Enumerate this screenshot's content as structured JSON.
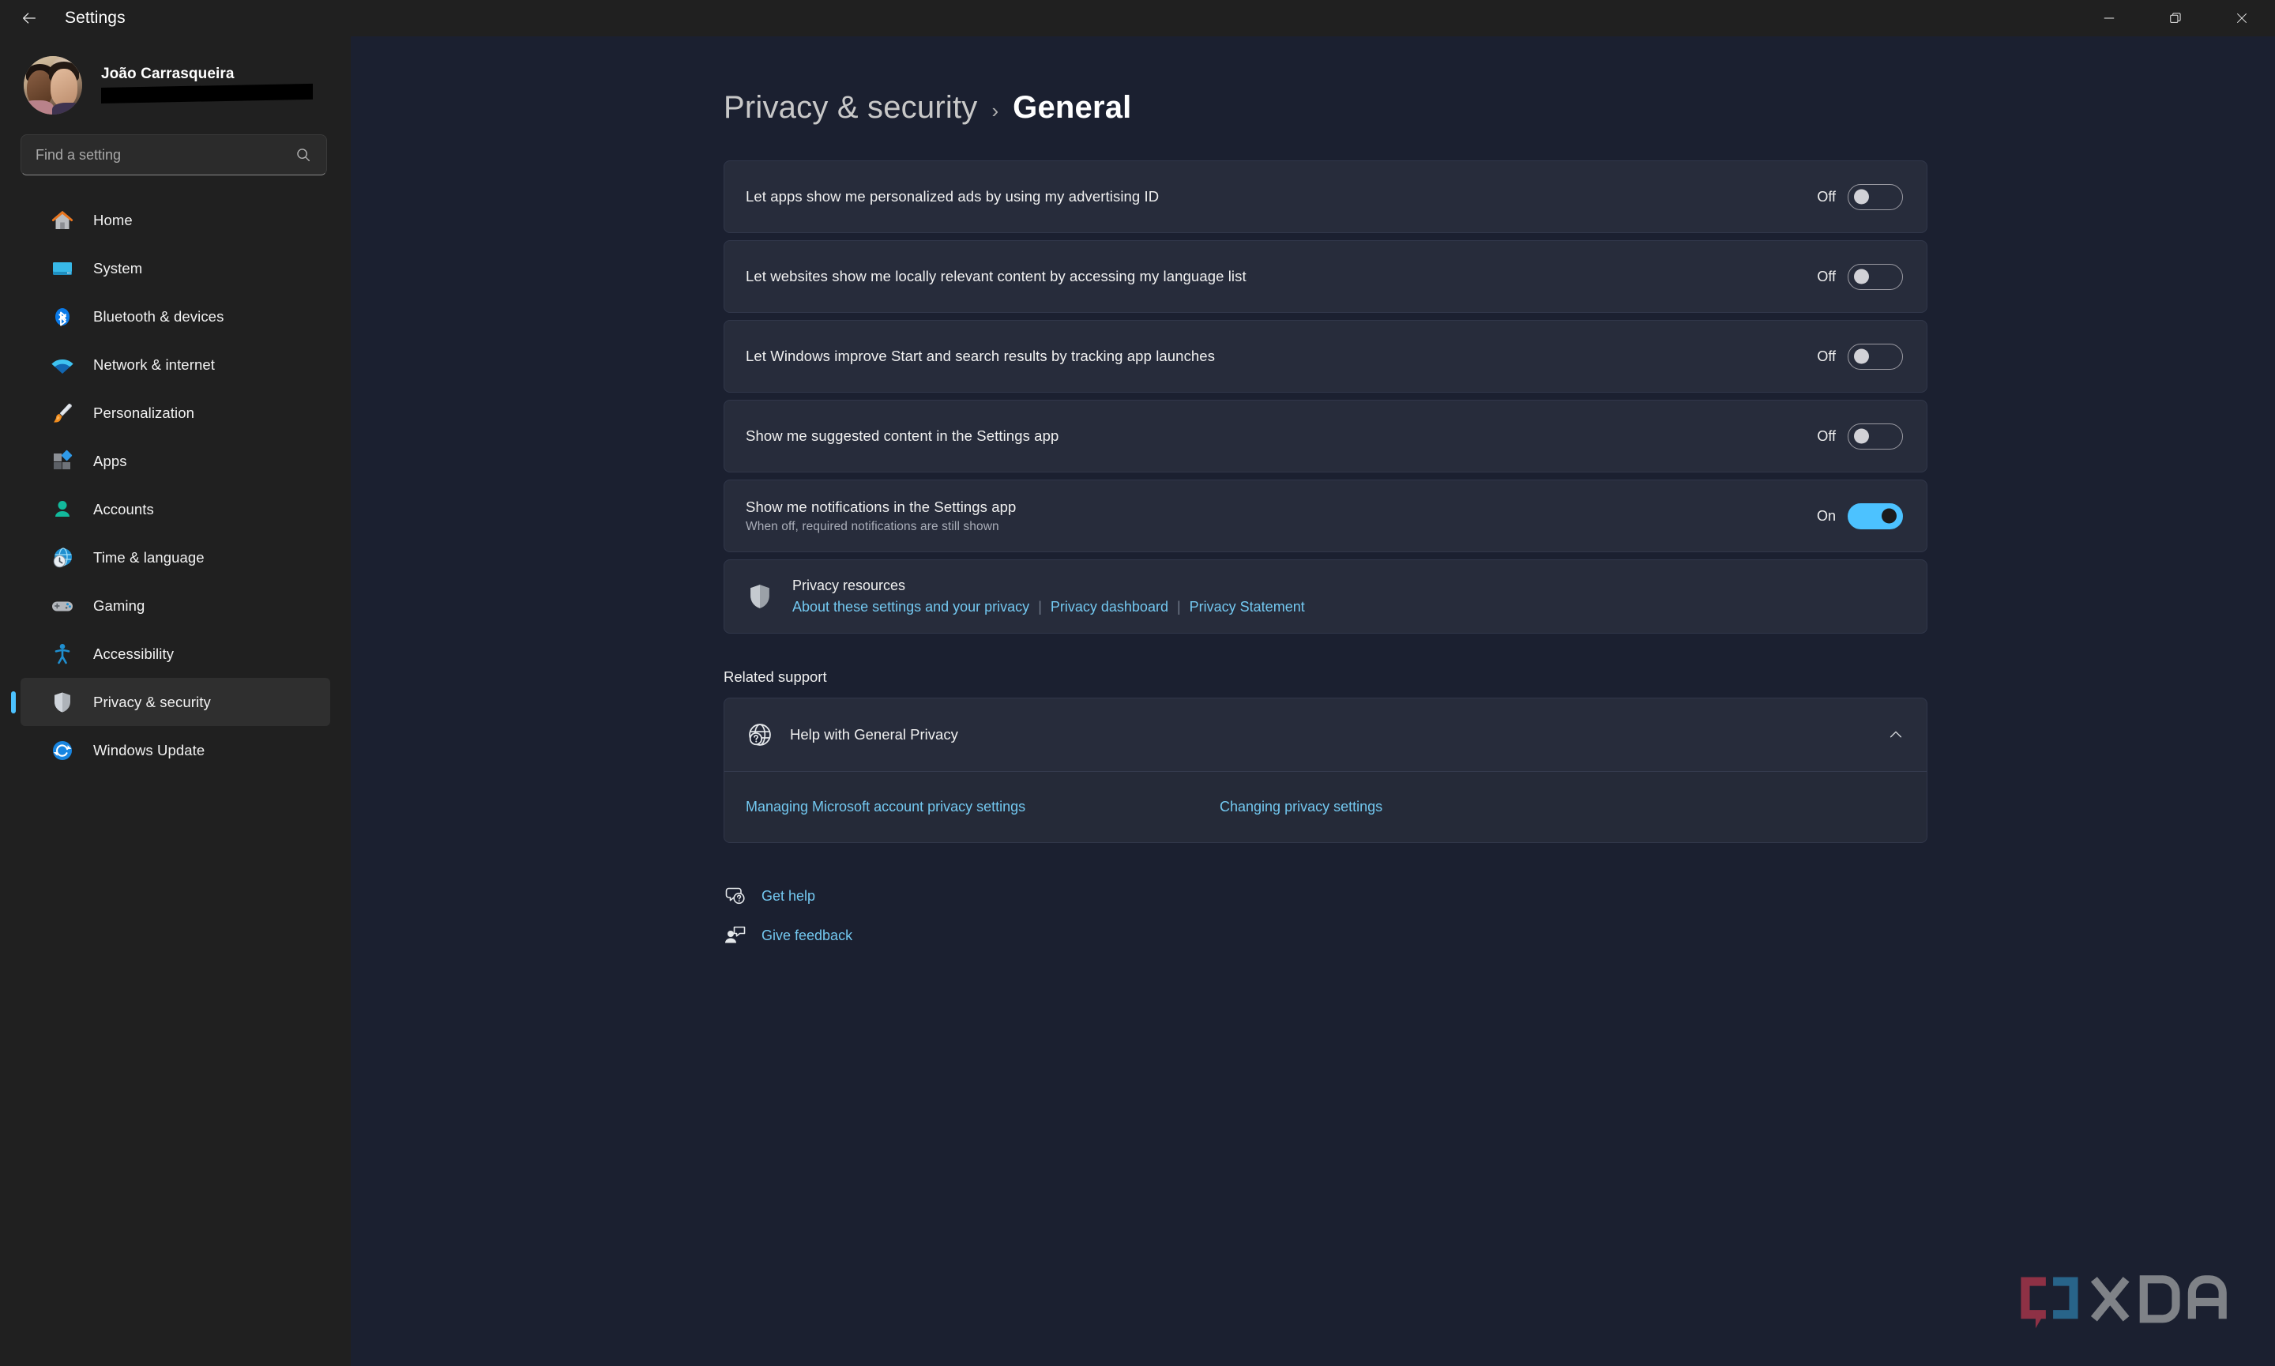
{
  "window": {
    "app_title": "Settings",
    "back_icon": "back-arrow-icon",
    "controls": {
      "minimize": "minimize-icon",
      "maximize": "restore-icon",
      "close": "close-icon"
    }
  },
  "sidebar": {
    "profile": {
      "name": "João Carrasqueira",
      "email_redacted": true
    },
    "search": {
      "placeholder": "Find a setting",
      "value": "",
      "icon": "search-icon"
    },
    "items": [
      {
        "label": "Home",
        "icon": "home-icon",
        "active": false
      },
      {
        "label": "System",
        "icon": "system-monitor-icon",
        "active": false
      },
      {
        "label": "Bluetooth & devices",
        "icon": "bluetooth-icon",
        "active": false
      },
      {
        "label": "Network & internet",
        "icon": "wifi-icon",
        "active": false
      },
      {
        "label": "Personalization",
        "icon": "paintbrush-icon",
        "active": false
      },
      {
        "label": "Apps",
        "icon": "apps-blocks-icon",
        "active": false
      },
      {
        "label": "Accounts",
        "icon": "person-icon",
        "active": false
      },
      {
        "label": "Time & language",
        "icon": "clock-globe-icon",
        "active": false
      },
      {
        "label": "Gaming",
        "icon": "gamepad-icon",
        "active": false
      },
      {
        "label": "Accessibility",
        "icon": "accessibility-person-icon",
        "active": false
      },
      {
        "label": "Privacy & security",
        "icon": "shield-icon",
        "active": true
      },
      {
        "label": "Windows Update",
        "icon": "update-refresh-icon",
        "active": false
      }
    ]
  },
  "main": {
    "breadcrumb": {
      "parent": "Privacy & security",
      "separator": "›",
      "current": "General"
    },
    "settings": [
      {
        "title": "Let apps show me personalized ads by using my advertising ID",
        "sub": "",
        "state": "Off",
        "on": false
      },
      {
        "title": "Let websites show me locally relevant content by accessing my language list",
        "sub": "",
        "state": "Off",
        "on": false
      },
      {
        "title": "Let Windows improve Start and search results by tracking app launches",
        "sub": "",
        "state": "Off",
        "on": false
      },
      {
        "title": "Show me suggested content in the Settings app",
        "sub": "",
        "state": "Off",
        "on": false
      },
      {
        "title": "Show me notifications in the Settings app",
        "sub": "When off, required notifications are still shown",
        "state": "On",
        "on": true
      }
    ],
    "privacy_resources": {
      "icon": "shield-icon",
      "title": "Privacy resources",
      "links": [
        "About these settings and your privacy",
        "Privacy dashboard",
        "Privacy Statement"
      ],
      "separator": "|"
    },
    "related_support": {
      "heading": "Related support",
      "help_item": {
        "icon": "help-globe-icon",
        "label": "Help with General Privacy",
        "chevron": "chevron-up-icon",
        "expanded": true
      },
      "links": [
        "Managing Microsoft account privacy settings",
        "Changing privacy settings"
      ]
    },
    "footer_links": [
      {
        "label": "Get help",
        "icon": "help-question-icon"
      },
      {
        "label": "Give feedback",
        "icon": "feedback-person-icon"
      }
    ]
  },
  "watermark": {
    "text": "XDA",
    "colors": {
      "bracket_red": "#9e3449",
      "bracket_blue": "#2a6e96",
      "text_gray": "#8d9094"
    }
  },
  "colors": {
    "accent": "#4cc2ff",
    "link": "#73c8f0",
    "sidebar_bg": "#202020",
    "content_bg": "#1b2030",
    "card_bg": "#272c3b"
  }
}
